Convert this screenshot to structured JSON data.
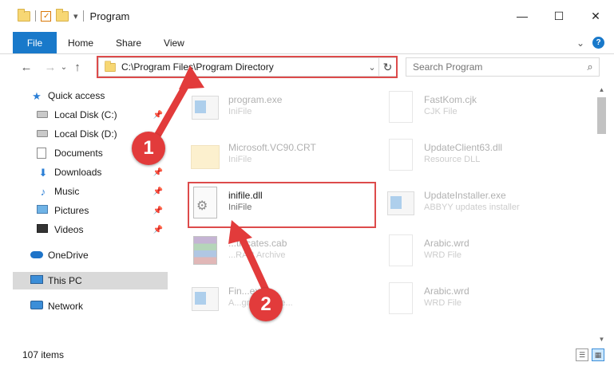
{
  "window": {
    "title": "Program",
    "minimize_glyph": "—",
    "maximize_glyph": "☐",
    "close_glyph": "✕"
  },
  "ribbon": {
    "tabs": [
      "File",
      "Home",
      "Share",
      "View"
    ],
    "expand_glyph": "⌄",
    "help_glyph": "?"
  },
  "navigation": {
    "back_glyph": "←",
    "forward_glyph": "→",
    "recent_glyph": "⌄",
    "up_glyph": "↑",
    "address": "C:\\Program Files\\Program Directory",
    "dropdown_glyph": "⌄",
    "refresh_glyph": "↻",
    "search_placeholder": "Search Program",
    "search_glyph": "⌕"
  },
  "sidebar": {
    "items": [
      {
        "label": "Quick access",
        "icon": "star-icon",
        "pinned": false
      },
      {
        "label": "Local Disk (C:)",
        "icon": "drive-icon",
        "pinned": true
      },
      {
        "label": "Local Disk (D:)",
        "icon": "drive-icon",
        "pinned": false
      },
      {
        "label": "Documents",
        "icon": "documents-icon",
        "pinned": true
      },
      {
        "label": "Downloads",
        "icon": "downloads-icon",
        "pinned": true
      },
      {
        "label": "Music",
        "icon": "music-icon",
        "pinned": true
      },
      {
        "label": "Pictures",
        "icon": "pictures-icon",
        "pinned": true
      },
      {
        "label": "Videos",
        "icon": "videos-icon",
        "pinned": true
      },
      {
        "label": "OneDrive",
        "icon": "onedrive-icon",
        "pinned": false
      },
      {
        "label": "This PC",
        "icon": "this-pc-icon",
        "pinned": false,
        "selected": true
      },
      {
        "label": "Network",
        "icon": "network-icon",
        "pinned": false
      }
    ],
    "pin_glyph": "📌"
  },
  "files": [
    {
      "name": "program.exe",
      "type": "IniFile",
      "icon": "exe-icon",
      "faded": true
    },
    {
      "name": "FastKom.cjk",
      "type": "CJK File",
      "icon": "document-icon",
      "faded": true
    },
    {
      "name": "Microsoft.VC90.CRT",
      "type": "IniFile",
      "icon": "folder-icon",
      "faded": true
    },
    {
      "name": "UpdateClient63.dll",
      "type": "Resource DLL",
      "icon": "document-icon",
      "faded": true
    },
    {
      "name": "inifile.dll",
      "type": "IniFile",
      "icon": "dll-gear-icon",
      "faded": false,
      "highlighted": true
    },
    {
      "name": "UpdateInstaller.exe",
      "type": "ABBYY updates installer",
      "icon": "exe-icon",
      "faded": true
    },
    {
      "name": "...tificates.cab",
      "type": "...RAR Archive",
      "icon": "archive-icon",
      "faded": true
    },
    {
      "name": "Arabic.wrd",
      "type": "WRD File",
      "icon": "document-icon",
      "faded": true
    },
    {
      "name": "Fin...exe",
      "type": "A...ground exe...",
      "icon": "exe-icon",
      "faded": true
    },
    {
      "name": "Arabic.wrd",
      "type": "WRD File",
      "icon": "document-icon",
      "faded": true
    }
  ],
  "scrollbar": {
    "up_glyph": "▲",
    "down_glyph": "▼"
  },
  "status": {
    "item_count": "107 items",
    "details_view_glyph": "☰",
    "icons_view_glyph": "▦"
  },
  "annotations": {
    "badge_1": "1",
    "badge_2": "2",
    "color": "#dd4b4b"
  }
}
